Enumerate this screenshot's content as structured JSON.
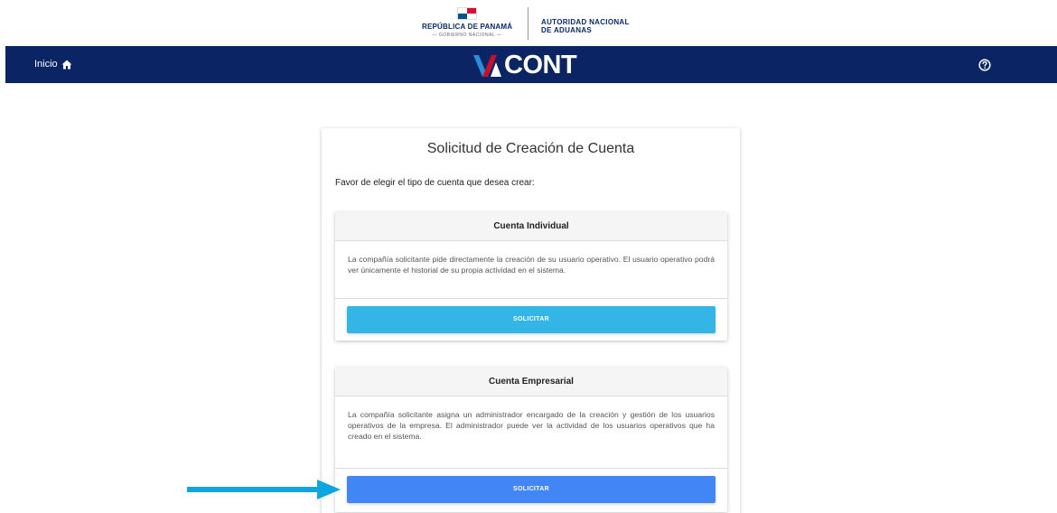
{
  "gov_banner": {
    "left_name": "REPÚBLICA DE PANAMÁ",
    "left_sub": "— GOBIERNO NACIONAL —",
    "right_line1": "AUTORIDAD NACIONAL",
    "right_line2": "DE ADUANAS",
    "flag_icon": "panama-flag-icon"
  },
  "navbar": {
    "home_label": "Inicio",
    "home_icon": "home-icon",
    "logo_text": "CONT",
    "logo_icon": "vacont-v-icon",
    "help_icon": "help-circle-icon",
    "bg_color": "#0b2463"
  },
  "card": {
    "title": "Solicitud de Creación de Cuenta",
    "intro": "Favor de elegir el tipo de cuenta que desea crear:",
    "options": [
      {
        "title": "Cuenta Individual",
        "description": "La compañía solicitante pide directamente la creación de su usuario operativo. El usuario operativo podrá ver únicamente el historial de su propia actividad en el sistema.",
        "button_label": "SOLICITAR",
        "button_color": "#33b5e5"
      },
      {
        "title": "Cuenta Empresarial",
        "description": "La compañía solicitante asigna un administrador encargado de la creación y gestión de los usuarios operativos de la empresa. El administrador puede ver la actividad de los usuarios operativos que ha creado en el sistema.",
        "button_label": "SOLICITAR",
        "button_color": "#4285f4"
      }
    ]
  },
  "annotation": {
    "arrow_color": "#0ea5e0"
  }
}
